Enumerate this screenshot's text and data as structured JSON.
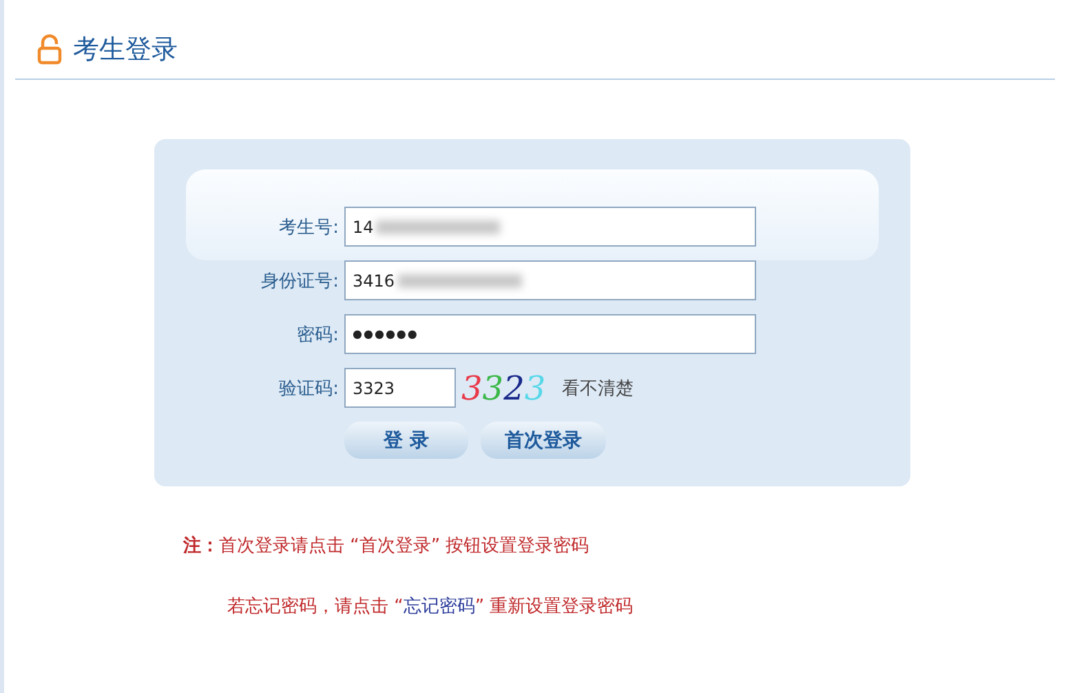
{
  "header": {
    "title": "考生登录"
  },
  "form": {
    "fields": [
      {
        "label": "考生号:",
        "value": "14",
        "kind": "text",
        "redacted": true
      },
      {
        "label": "身份证号:",
        "value": "3416",
        "kind": "text",
        "redacted": true
      },
      {
        "label": "密码:",
        "value": "●●●●●●",
        "kind": "password",
        "redacted": false
      }
    ],
    "captcha": {
      "label": "验证码:",
      "value": "3323",
      "chars": [
        {
          "text": "3",
          "color": "#e83a4a"
        },
        {
          "text": "3",
          "color": "#3cb84a"
        },
        {
          "text": "2",
          "color": "#1a2a8a"
        },
        {
          "text": "3",
          "color": "#58d8e8"
        }
      ],
      "refresh_link": "看不清楚"
    },
    "buttons": [
      "登 录",
      "首次登录"
    ]
  },
  "notes": {
    "label": "注：",
    "line1": "首次登录请点击 “首次登录” 按钮设置登录密码",
    "line2_before": "若忘记密码，请点击 “",
    "line2_link": "忘记密码",
    "line2_after": "” 重新设置登录密码"
  }
}
